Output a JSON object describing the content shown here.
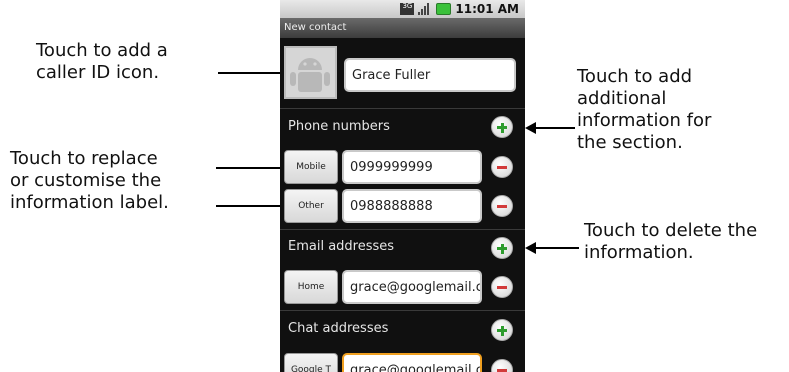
{
  "annotations": {
    "caller_id": "Touch to add a\ncaller ID icon.",
    "replace_label": "Touch to replace\nor customise the\ninformation label.",
    "add_info": "Touch to add\nadditional\ninformation for\nthe section.",
    "delete_info": "Touch to delete the\ninformation."
  },
  "statusbar": {
    "time": "11:01 AM",
    "network": "3G"
  },
  "title": "New contact",
  "contact": {
    "name": "Grace Fuller"
  },
  "sections": {
    "phone": {
      "title": "Phone numbers",
      "entries": [
        {
          "label": "Mobile",
          "value": "0999999999"
        },
        {
          "label": "Other",
          "value": "0988888888"
        }
      ]
    },
    "email": {
      "title": "Email addresses",
      "entries": [
        {
          "label": "Home",
          "value": "grace@googlemail.c"
        }
      ]
    },
    "chat": {
      "title": "Chat addresses",
      "entries": [
        {
          "label": "Google T",
          "value": "grace@googlemail.c"
        }
      ]
    }
  },
  "colors": {
    "add": "#2e9c2e",
    "remove": "#d23a3a",
    "focus": "#f0a020"
  }
}
